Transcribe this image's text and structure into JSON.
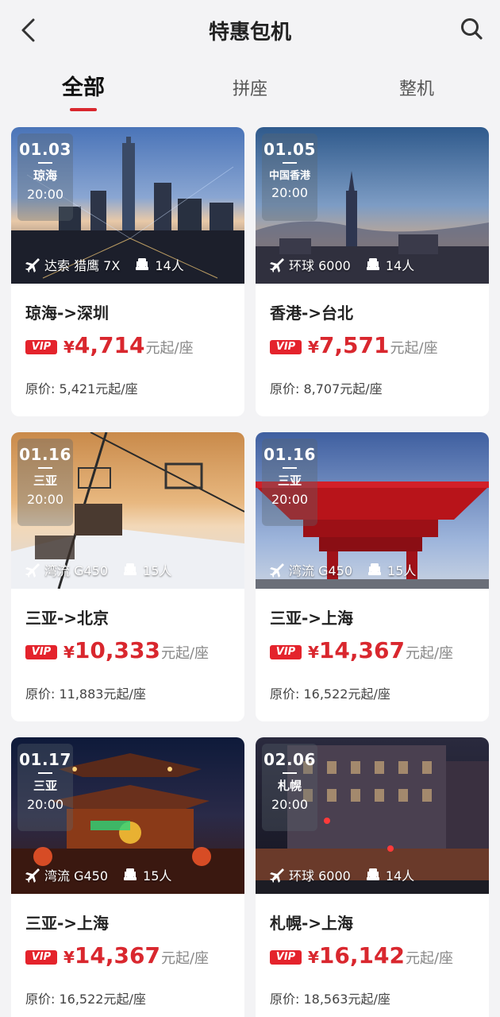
{
  "header": {
    "title": "特惠包机",
    "back_icon": "chevron-left-icon",
    "search_icon": "search-icon"
  },
  "tabs": [
    {
      "label": "全部",
      "active": true
    },
    {
      "label": "拼座",
      "active": false
    },
    {
      "label": "整机",
      "active": false
    }
  ],
  "accent_color": "#d9272e",
  "vip_label": "VIP",
  "yen": "¥",
  "unit": "元起/座",
  "cards": [
    {
      "date": "01.03",
      "city": "琼海",
      "time": "20:00",
      "aircraft": "达索 猎鹰 7X",
      "seats": "14人",
      "route": "琼海->深圳",
      "price": "4,714",
      "original": "原价: 5,421元起/座",
      "scene": "city-night"
    },
    {
      "date": "01.05",
      "city": "中国香港",
      "time": "20:00",
      "aircraft": "环球 6000",
      "seats": "14人",
      "route": "香港->台北",
      "price": "7,571",
      "original": "原价: 8,707元起/座",
      "scene": "tower-dusk"
    },
    {
      "date": "01.16",
      "city": "三亚",
      "time": "20:00",
      "aircraft": "湾流 G450",
      "seats": "15人",
      "route": "三亚->北京",
      "price": "10,333",
      "original": "原价: 11,883元起/座",
      "scene": "ski-lift"
    },
    {
      "date": "01.16",
      "city": "三亚",
      "time": "20:00",
      "aircraft": "湾流 G450",
      "seats": "15人",
      "route": "三亚->上海",
      "price": "14,367",
      "original": "原价: 16,522元起/座",
      "scene": "china-pavilion"
    },
    {
      "date": "01.17",
      "city": "三亚",
      "time": "20:00",
      "aircraft": "湾流 G450",
      "seats": "15人",
      "route": "三亚->上海",
      "price": "14,367",
      "original": "原价: 16,522元起/座",
      "scene": "yuyuan-night"
    },
    {
      "date": "02.06",
      "city": "札幌",
      "time": "20:00",
      "aircraft": "环球 6000",
      "seats": "14人",
      "route": "札幌->上海",
      "price": "16,142",
      "original": "原价: 18,563元起/座",
      "scene": "bund-building"
    }
  ]
}
